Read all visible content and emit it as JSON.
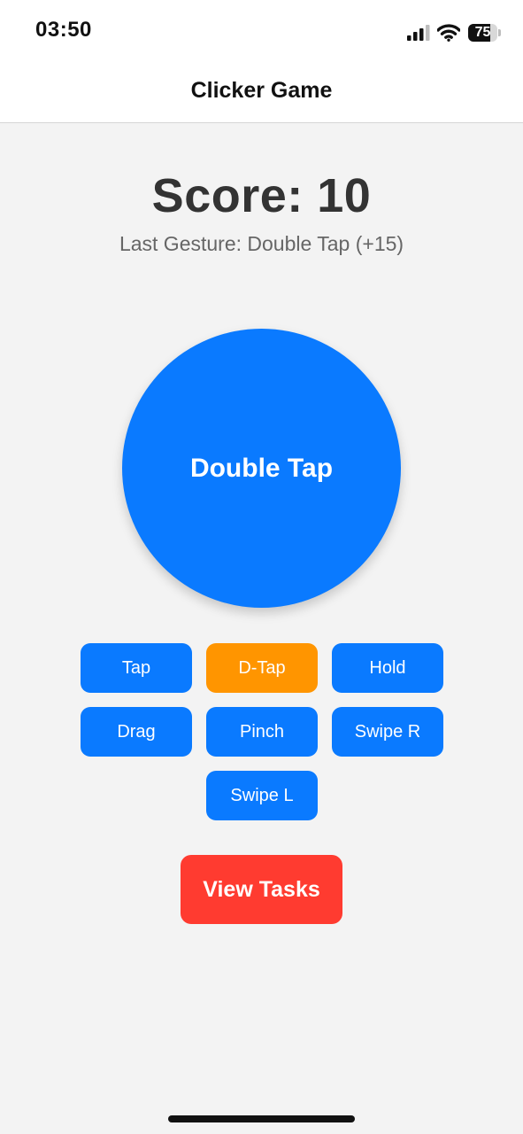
{
  "status_bar": {
    "time": "03:50",
    "battery_text": "75",
    "battery_level": 0.75,
    "icons": [
      "cellular-signal-icon",
      "wifi-icon",
      "battery-icon"
    ]
  },
  "header": {
    "title": "Clicker Game"
  },
  "score": {
    "text": "Score: 10",
    "last_gesture": "Last Gesture: Double Tap (+15)"
  },
  "gesture_target": {
    "label": "Double Tap",
    "color": "#0a7aff"
  },
  "gestures": {
    "items": [
      {
        "label": "Tap",
        "active": false
      },
      {
        "label": "D-Tap",
        "active": true
      },
      {
        "label": "Hold",
        "active": false
      },
      {
        "label": "Drag",
        "active": false
      },
      {
        "label": "Pinch",
        "active": false
      },
      {
        "label": "Swipe R",
        "active": false
      },
      {
        "label": "Swipe L",
        "active": false
      }
    ]
  },
  "actions": {
    "view_tasks": "View Tasks"
  },
  "colors": {
    "primary": "#0a7aff",
    "active": "#ff9500",
    "danger": "#ff3b30",
    "background": "#f3f3f3"
  }
}
